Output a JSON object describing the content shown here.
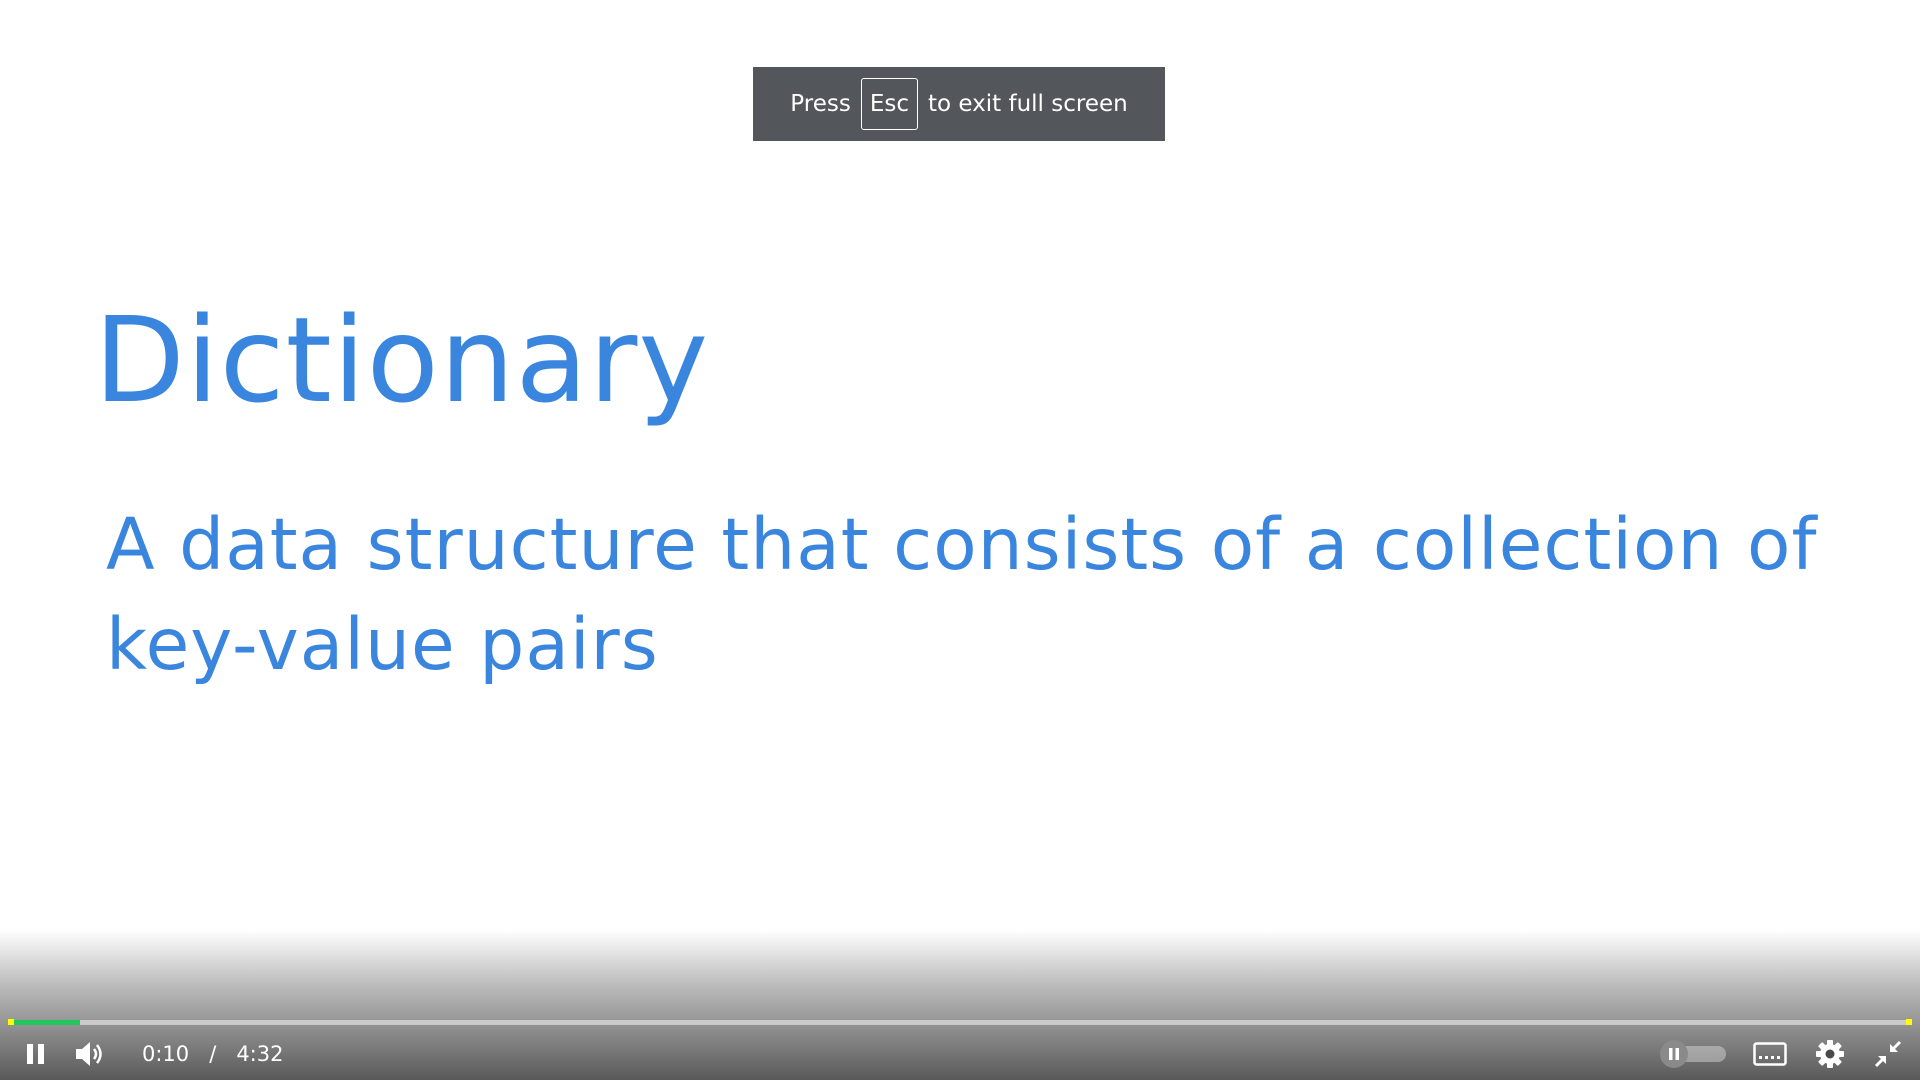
{
  "slide": {
    "title": "Dictionary",
    "body": "A data structure that consists of a collection of key-value pairs"
  },
  "fullscreen_toast": {
    "prefix": "Press",
    "key": "Esc",
    "suffix": "to exit full screen"
  },
  "player": {
    "current_time": "0:10",
    "separator": "/",
    "duration": "4:32",
    "progress_fraction": 0.037,
    "progress_color": "#22c55e",
    "marker_color": "#ffff00",
    "state": "playing",
    "icons": {
      "play_pause": "pause-icon",
      "volume": "volume-icon",
      "autoplay": "autoplay-toggle",
      "captions": "captions-icon",
      "settings": "gear-icon",
      "fullscreen": "exit-fullscreen-icon"
    }
  },
  "colors": {
    "slide_text": "#3a86de",
    "toast_bg": "#53565a"
  }
}
